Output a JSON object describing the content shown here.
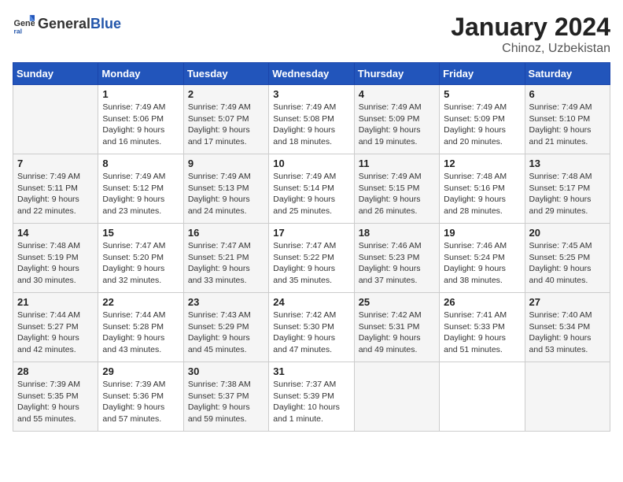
{
  "logo": {
    "text_general": "General",
    "text_blue": "Blue"
  },
  "title": "January 2024",
  "subtitle": "Chinoz, Uzbekistan",
  "days_of_week": [
    "Sunday",
    "Monday",
    "Tuesday",
    "Wednesday",
    "Thursday",
    "Friday",
    "Saturday"
  ],
  "weeks": [
    [
      {
        "day": "",
        "info": ""
      },
      {
        "day": "1",
        "info": "Sunrise: 7:49 AM\nSunset: 5:06 PM\nDaylight: 9 hours\nand 16 minutes."
      },
      {
        "day": "2",
        "info": "Sunrise: 7:49 AM\nSunset: 5:07 PM\nDaylight: 9 hours\nand 17 minutes."
      },
      {
        "day": "3",
        "info": "Sunrise: 7:49 AM\nSunset: 5:08 PM\nDaylight: 9 hours\nand 18 minutes."
      },
      {
        "day": "4",
        "info": "Sunrise: 7:49 AM\nSunset: 5:09 PM\nDaylight: 9 hours\nand 19 minutes."
      },
      {
        "day": "5",
        "info": "Sunrise: 7:49 AM\nSunset: 5:09 PM\nDaylight: 9 hours\nand 20 minutes."
      },
      {
        "day": "6",
        "info": "Sunrise: 7:49 AM\nSunset: 5:10 PM\nDaylight: 9 hours\nand 21 minutes."
      }
    ],
    [
      {
        "day": "7",
        "info": "Sunrise: 7:49 AM\nSunset: 5:11 PM\nDaylight: 9 hours\nand 22 minutes."
      },
      {
        "day": "8",
        "info": "Sunrise: 7:49 AM\nSunset: 5:12 PM\nDaylight: 9 hours\nand 23 minutes."
      },
      {
        "day": "9",
        "info": "Sunrise: 7:49 AM\nSunset: 5:13 PM\nDaylight: 9 hours\nand 24 minutes."
      },
      {
        "day": "10",
        "info": "Sunrise: 7:49 AM\nSunset: 5:14 PM\nDaylight: 9 hours\nand 25 minutes."
      },
      {
        "day": "11",
        "info": "Sunrise: 7:49 AM\nSunset: 5:15 PM\nDaylight: 9 hours\nand 26 minutes."
      },
      {
        "day": "12",
        "info": "Sunrise: 7:48 AM\nSunset: 5:16 PM\nDaylight: 9 hours\nand 28 minutes."
      },
      {
        "day": "13",
        "info": "Sunrise: 7:48 AM\nSunset: 5:17 PM\nDaylight: 9 hours\nand 29 minutes."
      }
    ],
    [
      {
        "day": "14",
        "info": "Sunrise: 7:48 AM\nSunset: 5:19 PM\nDaylight: 9 hours\nand 30 minutes."
      },
      {
        "day": "15",
        "info": "Sunrise: 7:47 AM\nSunset: 5:20 PM\nDaylight: 9 hours\nand 32 minutes."
      },
      {
        "day": "16",
        "info": "Sunrise: 7:47 AM\nSunset: 5:21 PM\nDaylight: 9 hours\nand 33 minutes."
      },
      {
        "day": "17",
        "info": "Sunrise: 7:47 AM\nSunset: 5:22 PM\nDaylight: 9 hours\nand 35 minutes."
      },
      {
        "day": "18",
        "info": "Sunrise: 7:46 AM\nSunset: 5:23 PM\nDaylight: 9 hours\nand 37 minutes."
      },
      {
        "day": "19",
        "info": "Sunrise: 7:46 AM\nSunset: 5:24 PM\nDaylight: 9 hours\nand 38 minutes."
      },
      {
        "day": "20",
        "info": "Sunrise: 7:45 AM\nSunset: 5:25 PM\nDaylight: 9 hours\nand 40 minutes."
      }
    ],
    [
      {
        "day": "21",
        "info": "Sunrise: 7:44 AM\nSunset: 5:27 PM\nDaylight: 9 hours\nand 42 minutes."
      },
      {
        "day": "22",
        "info": "Sunrise: 7:44 AM\nSunset: 5:28 PM\nDaylight: 9 hours\nand 43 minutes."
      },
      {
        "day": "23",
        "info": "Sunrise: 7:43 AM\nSunset: 5:29 PM\nDaylight: 9 hours\nand 45 minutes."
      },
      {
        "day": "24",
        "info": "Sunrise: 7:42 AM\nSunset: 5:30 PM\nDaylight: 9 hours\nand 47 minutes."
      },
      {
        "day": "25",
        "info": "Sunrise: 7:42 AM\nSunset: 5:31 PM\nDaylight: 9 hours\nand 49 minutes."
      },
      {
        "day": "26",
        "info": "Sunrise: 7:41 AM\nSunset: 5:33 PM\nDaylight: 9 hours\nand 51 minutes."
      },
      {
        "day": "27",
        "info": "Sunrise: 7:40 AM\nSunset: 5:34 PM\nDaylight: 9 hours\nand 53 minutes."
      }
    ],
    [
      {
        "day": "28",
        "info": "Sunrise: 7:39 AM\nSunset: 5:35 PM\nDaylight: 9 hours\nand 55 minutes."
      },
      {
        "day": "29",
        "info": "Sunrise: 7:39 AM\nSunset: 5:36 PM\nDaylight: 9 hours\nand 57 minutes."
      },
      {
        "day": "30",
        "info": "Sunrise: 7:38 AM\nSunset: 5:37 PM\nDaylight: 9 hours\nand 59 minutes."
      },
      {
        "day": "31",
        "info": "Sunrise: 7:37 AM\nSunset: 5:39 PM\nDaylight: 10 hours\nand 1 minute."
      },
      {
        "day": "",
        "info": ""
      },
      {
        "day": "",
        "info": ""
      },
      {
        "day": "",
        "info": ""
      }
    ]
  ]
}
